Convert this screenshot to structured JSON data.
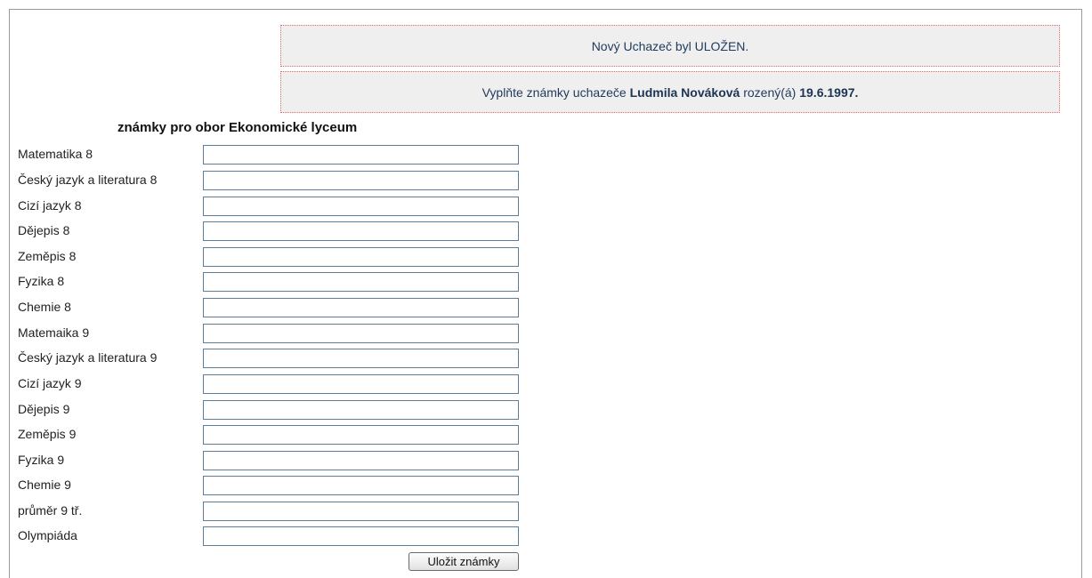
{
  "messages": {
    "saved": "Nový Uchazeč byl ULOŽEN.",
    "fill_prefix": "Vyplňte známky uchazeče",
    "candidate_name": "Ludmila Nováková",
    "born_label": "rozený(á)",
    "birth_date": "19.6.1997."
  },
  "form": {
    "heading": "známky pro obor Ekonomické lyceum",
    "fields": [
      {
        "label": "Matematika 8",
        "value": ""
      },
      {
        "label": "Český jazyk a literatura 8",
        "value": ""
      },
      {
        "label": "Cizí jazyk 8",
        "value": ""
      },
      {
        "label": "Dějepis 8",
        "value": ""
      },
      {
        "label": "Zeměpis 8",
        "value": ""
      },
      {
        "label": "Fyzika 8",
        "value": ""
      },
      {
        "label": "Chemie 8",
        "value": ""
      },
      {
        "label": "Matemaika 9",
        "value": ""
      },
      {
        "label": "Český jazyk a literatura 9",
        "value": ""
      },
      {
        "label": "Cizí jazyk 9",
        "value": ""
      },
      {
        "label": "Dějepis 9",
        "value": ""
      },
      {
        "label": "Zeměpis 9",
        "value": ""
      },
      {
        "label": "Fyzika 9",
        "value": ""
      },
      {
        "label": "Chemie 9",
        "value": ""
      },
      {
        "label": "průměr 9 tř.",
        "value": ""
      },
      {
        "label": "Olympiáda",
        "value": ""
      }
    ],
    "submit_label": "Uložit známky"
  }
}
